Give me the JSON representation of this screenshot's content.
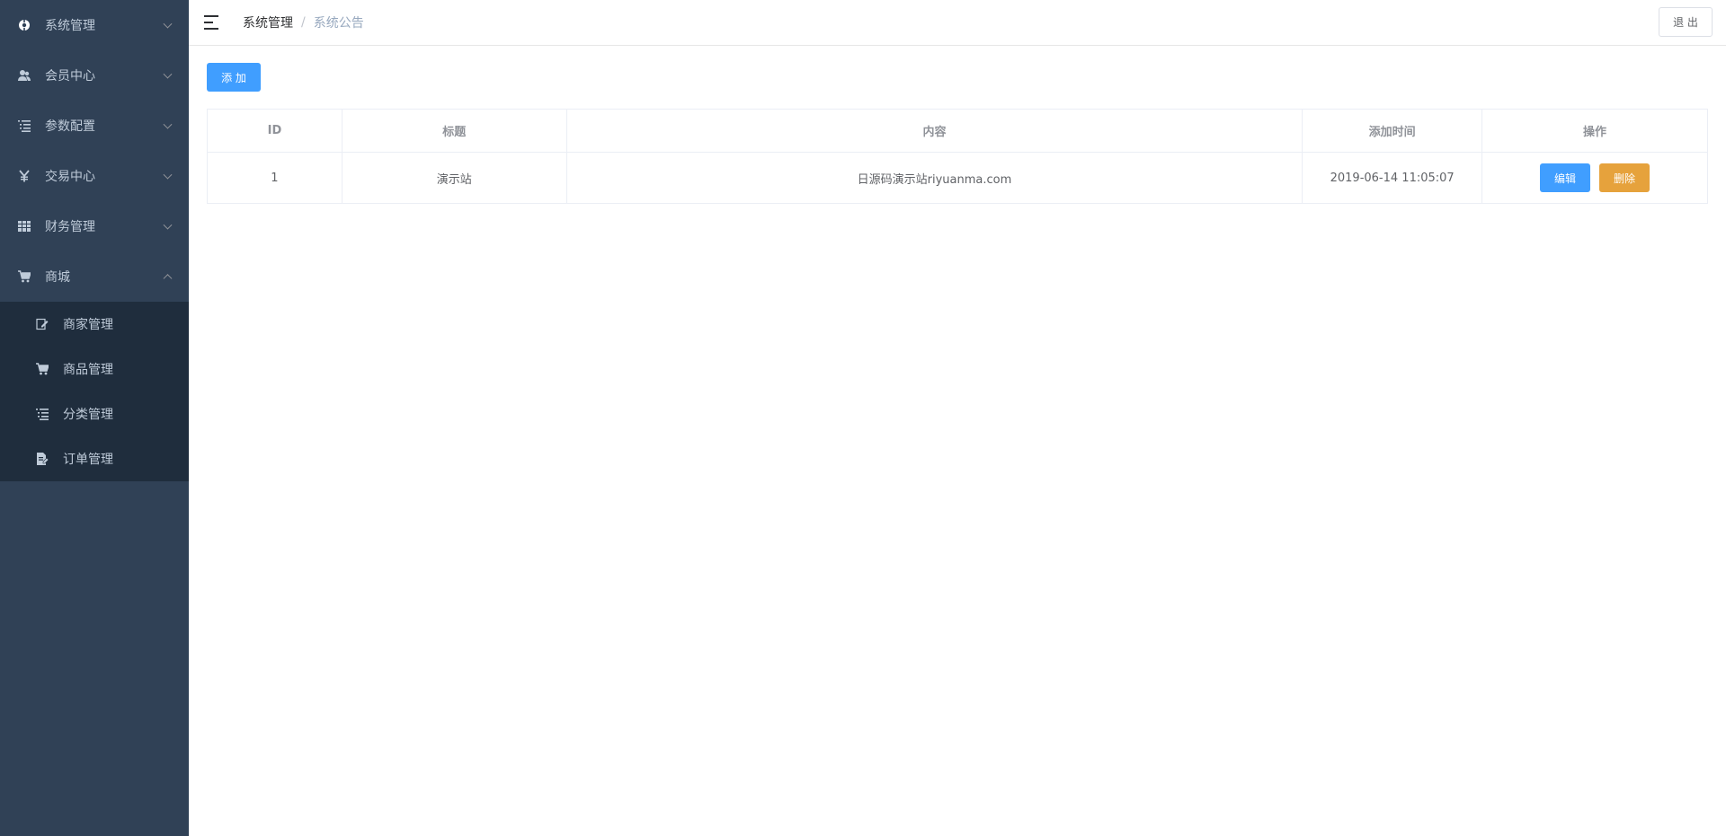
{
  "sidebar": {
    "items": [
      {
        "label": "系统管理",
        "icon": "system-icon"
      },
      {
        "label": "会员中心",
        "icon": "user-icon"
      },
      {
        "label": "参数配置",
        "icon": "list-icon"
      },
      {
        "label": "交易中心",
        "icon": "yen-icon"
      },
      {
        "label": "财务管理",
        "icon": "grid-icon"
      },
      {
        "label": "商城",
        "icon": "cart-icon"
      }
    ],
    "submenu": [
      {
        "label": "商家管理",
        "icon": "edit-doc-icon"
      },
      {
        "label": "商品管理",
        "icon": "cart-icon"
      },
      {
        "label": "分类管理",
        "icon": "list-icon"
      },
      {
        "label": "订单管理",
        "icon": "order-doc-icon"
      }
    ]
  },
  "header": {
    "breadcrumb": [
      "系统管理",
      "系统公告"
    ],
    "separator": "/",
    "logout_label": "退 出"
  },
  "main": {
    "add_label": "添 加",
    "table": {
      "columns": [
        "ID",
        "标题",
        "内容",
        "添加时间",
        "操作"
      ],
      "rows": [
        {
          "id": "1",
          "title": "演示站",
          "content": "日源码演示站riyuanma.com",
          "time": "2019-06-14 11:05:07",
          "edit_label": "编辑",
          "delete_label": "删除"
        }
      ]
    }
  },
  "colors": {
    "sidebar_bg": "#304156",
    "submenu_bg": "#1f2d3d",
    "primary": "#409eff",
    "warning": "#e6a23c"
  }
}
